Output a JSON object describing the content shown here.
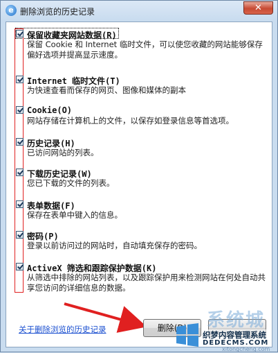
{
  "window": {
    "title": "删除浏览的历史记录",
    "close_label": "✕"
  },
  "options": [
    {
      "title": "保留收藏夹网站数据(R)",
      "desc": "保留 Cookie 和 Internet 临时文件，可以使您收藏的网站能够保存偏好选项并提高显示速度。",
      "checked": true
    },
    {
      "title": "Internet 临时文件(T)",
      "desc": "为快速查看而保存的网页、图像和媒体的副本",
      "checked": true
    },
    {
      "title": "Cookie(O)",
      "desc": "网站存储在计算机上的文件，以保存如登录信息等首选项。",
      "checked": true
    },
    {
      "title": "历史记录(H)",
      "desc": "已访问网站的列表。",
      "checked": true
    },
    {
      "title": "下载历史记录(W)",
      "desc": "您已下载的文件的列表。",
      "checked": true
    },
    {
      "title": "表单数据(F)",
      "desc": "保存在表单中键入的信息。",
      "checked": true
    },
    {
      "title": "密码(P)",
      "desc": "登录以前访问过的网站时，自动填充保存的密码。",
      "checked": true
    },
    {
      "title": "ActiveX 筛选和跟踪保护数据(K)",
      "desc": "从筛选中排除的网站列表，以及跟踪保护用来检测网站在何处自动共享您访问的详细信息的数据。",
      "checked": true
    }
  ],
  "footer": {
    "help_link": "关于删除浏览的历史记录",
    "delete_label": "删除(D)"
  },
  "watermark": {
    "big_text": "系统城",
    "line1": "织梦内容管理系统",
    "line2": "DEDECMS.COM",
    "line3": "xitongcheng.com"
  },
  "colors": {
    "annotation_red": "#e02020",
    "link_blue": "#1a4fd0"
  }
}
